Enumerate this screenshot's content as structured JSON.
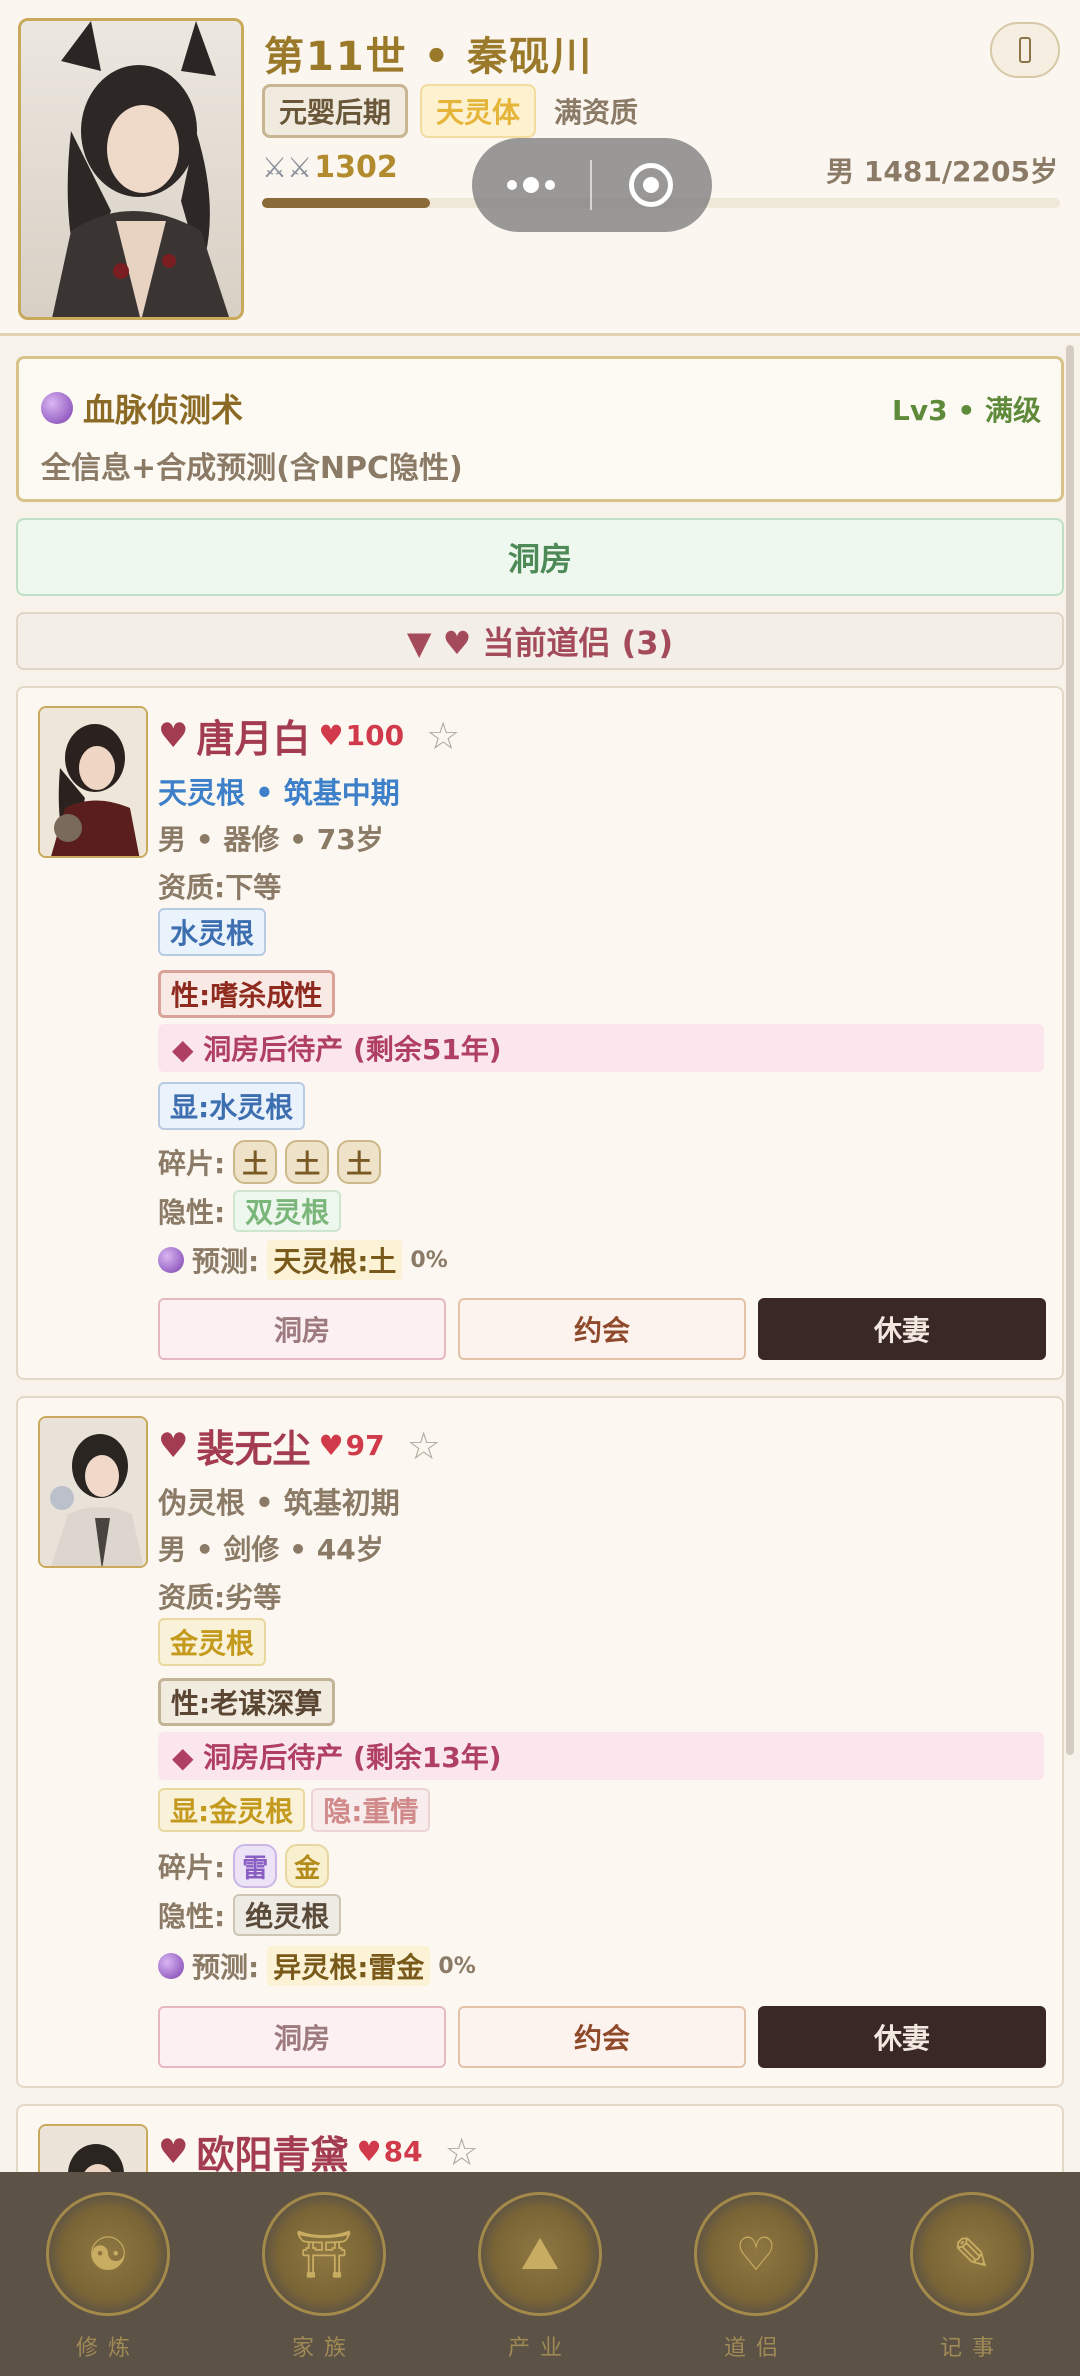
{
  "header": {
    "title": "第11世 • 秦砚川",
    "tags": {
      "realm": "元婴后期",
      "body": "天灵体",
      "aptitude": "满资质"
    },
    "power": "1302",
    "gender_count": "男 1481/2205岁",
    "progress": 0.21
  },
  "skill": {
    "name": "血脉侦测术",
    "level": "Lv3 • 满级",
    "description": "全信息+合成预测(含NPC隐性)"
  },
  "bridal_button": "洞房",
  "section_title": "▼ ♥ 当前道侣 (3)",
  "partners": [
    {
      "name": "唐月白",
      "affection": "100",
      "root_realm": "天灵根 • 筑基中期",
      "root_realm_color": "#3d7fc8",
      "meta": "男 • 器修 • 73岁",
      "aptitude": "资质:下等",
      "root_chip": "水灵根",
      "trait": "性:嗜杀成性",
      "pending": "◆ 洞房后待产 (剩余51年)",
      "shown": "显:水灵根",
      "fragments_label": "碎片:",
      "fragments": [
        "土",
        "土",
        "土"
      ],
      "hidden_label": "隐性:",
      "hidden": "双灵根",
      "predict_label": "预测:",
      "predict": "天灵根:土",
      "predict_pct": "0%",
      "actions": {
        "bridal": "洞房",
        "date": "约会",
        "divorce": "休妻"
      }
    },
    {
      "name": "裴无尘",
      "affection": "97",
      "root_realm": "伪灵根 • 筑基初期",
      "root_realm_color": "#8a7a66",
      "meta": "男 • 剑修 • 44岁",
      "aptitude": "资质:劣等",
      "root_chip": "金灵根",
      "trait": "性:老谋深算",
      "pending": "◆ 洞房后待产 (剩余13年)",
      "shown": "显:金灵根",
      "hidden_love": "隐:重情",
      "fragments_label": "碎片:",
      "fragments": [
        "雷",
        "金"
      ],
      "hidden_label": "隐性:",
      "hidden": "绝灵根",
      "predict_label": "预测:",
      "predict": "异灵根:雷金",
      "predict_pct": "0%",
      "actions": {
        "bridal": "洞房",
        "date": "约会",
        "divorce": "休妻"
      }
    },
    {
      "name": "欧阳青黛",
      "affection": "84"
    }
  ],
  "tabs": [
    {
      "label": "修炼",
      "icon": "meditation-icon"
    },
    {
      "label": "家族",
      "icon": "pavilion-icon"
    },
    {
      "label": "产业",
      "icon": "mountain-icon"
    },
    {
      "label": "道侣",
      "icon": "couple-icon"
    },
    {
      "label": "记事",
      "icon": "scroll-icon"
    }
  ],
  "colors": {
    "accent": "#a33c50",
    "gold": "#9a7a2a",
    "tabbar": "#5c5246"
  }
}
